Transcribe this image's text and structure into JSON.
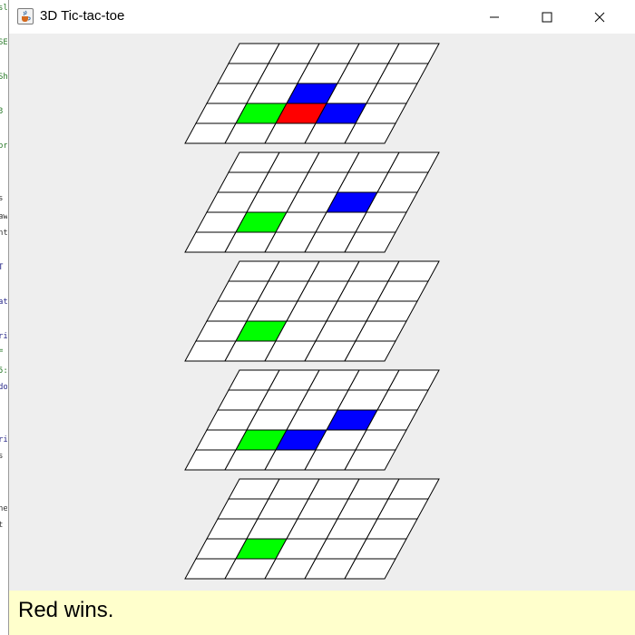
{
  "window": {
    "title": "3D Tic-tac-toe",
    "icon": "java-cup-icon",
    "controls": [
      "minimize-icon",
      "maximize-icon",
      "close-icon"
    ]
  },
  "game": {
    "board_size": 5,
    "layers": 5,
    "colors": {
      "empty": "#ffffff",
      "grid_line": "#000000",
      "green": "#00ff00",
      "blue": "#0000ff",
      "red": "#ff0000"
    },
    "cells": [
      [
        {
          "row": 2,
          "col": 2,
          "color": "blue"
        },
        {
          "row": 3,
          "col": 1,
          "color": "green"
        },
        {
          "row": 3,
          "col": 2,
          "color": "red"
        },
        {
          "row": 3,
          "col": 3,
          "color": "blue"
        }
      ],
      [
        {
          "row": 2,
          "col": 3,
          "color": "blue"
        },
        {
          "row": 3,
          "col": 1,
          "color": "green"
        }
      ],
      [
        {
          "row": 3,
          "col": 1,
          "color": "green"
        }
      ],
      [
        {
          "row": 2,
          "col": 3,
          "color": "blue"
        },
        {
          "row": 3,
          "col": 1,
          "color": "green"
        },
        {
          "row": 3,
          "col": 2,
          "color": "blue"
        }
      ],
      [
        {
          "row": 3,
          "col": 1,
          "color": "green"
        }
      ]
    ]
  },
  "status": {
    "message": "Red wins."
  }
}
